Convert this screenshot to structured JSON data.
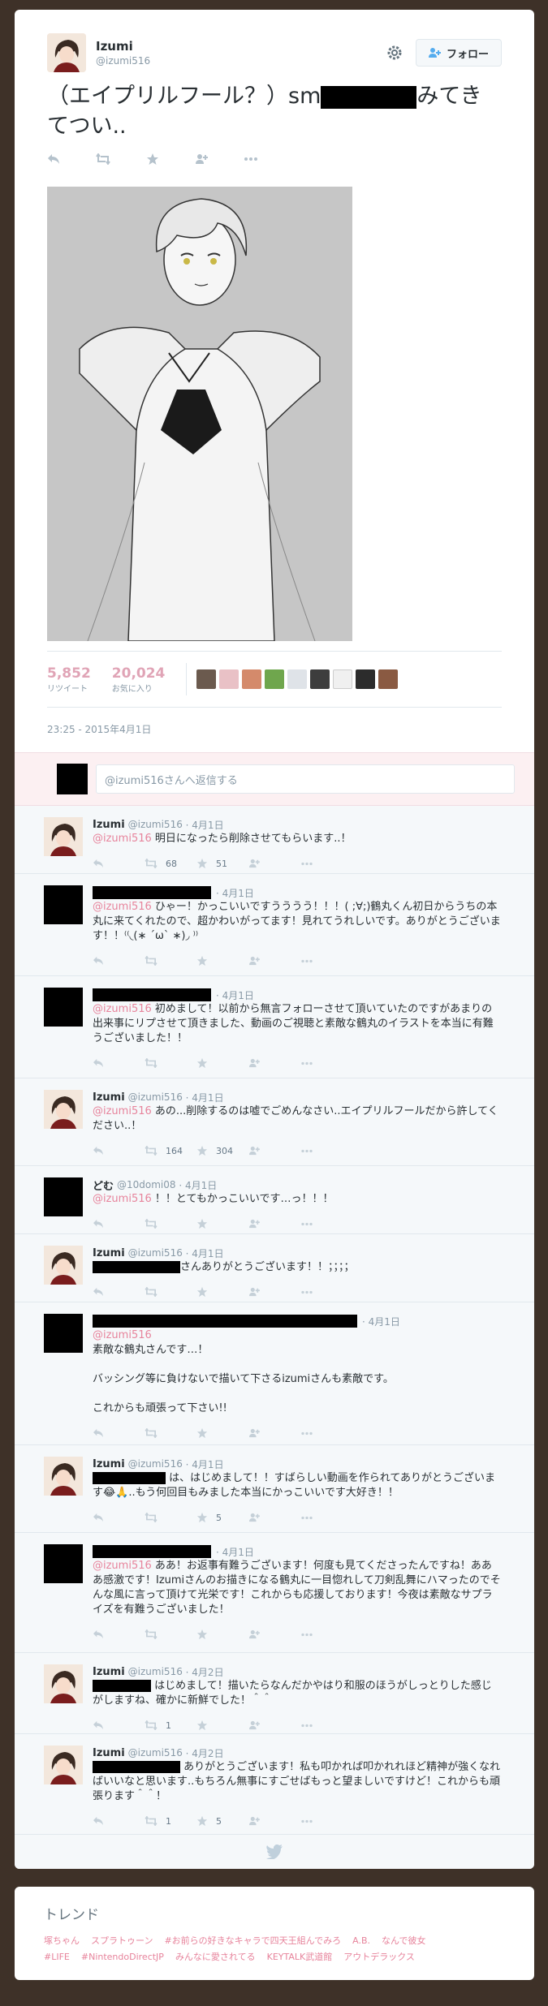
{
  "tweet": {
    "author_name": "Izumi",
    "author_handle": "@izumi516",
    "follow_label": "フォロー",
    "text_before": "（エイプリルフール？）sm",
    "text_after": "みてきてつい..",
    "retweets_count": "5,852",
    "retweets_label": "リツイート",
    "likes_count": "20,024",
    "likes_label": "お気に入り",
    "timestamp": "23:25 - 2015年4月1日"
  },
  "reply_box": {
    "placeholder": "@izumi516さんへ返信する"
  },
  "replies": [
    {
      "name": "Izumi",
      "handle": "@izumi516",
      "date": "· 4月1日",
      "mention": "@izumi516",
      "text": " 明日になったら削除させてもらいます..！",
      "rt": "68",
      "fav": "51"
    },
    {
      "name": "",
      "handle": "",
      "date": "· 4月1日",
      "mention": "@izumi516",
      "text": " ひゃー！かっこいいですうううう！！！( ;∀;)鶴丸くん初日からうちの本丸に来てくれたので、超かわいがってます！見れてうれしいです。ありがとうございます！！⁽⁽◟(∗ ˊωˋ ∗)◞ ⁾⁾",
      "rt": "",
      "fav": ""
    },
    {
      "name": "",
      "handle": "",
      "date": "· 4月1日",
      "mention": "@izumi516",
      "text": " 初めまして！以前から無言フォローさせて頂いていたのですがあまりの出来事にリプさせて頂きました、動画のご視聴と素敵な鶴丸のイラストを本当に有難うございました！！",
      "rt": "",
      "fav": ""
    },
    {
      "name": "Izumi",
      "handle": "@izumi516",
      "date": "· 4月1日",
      "mention": "@izumi516",
      "text": " あの...削除するのは嘘でごめんなさい..エイプリルフールだから許してください..！",
      "rt": "164",
      "fav": "304"
    },
    {
      "name": "どむ",
      "handle": "@10domi08",
      "date": "· 4月1日",
      "mention": "@izumi516",
      "text": " ！！とてもかっこいいです…っ！！！",
      "rt": "",
      "fav": ""
    },
    {
      "name": "Izumi",
      "handle": "@izumi516",
      "date": "· 4月1日",
      "mention": "",
      "text": "さんありがとうございます！！；；；；",
      "rt": "",
      "fav": ""
    },
    {
      "name": "",
      "handle": "",
      "date": "· 4月1日",
      "mention": "@izumi516",
      "text": "素敵な鶴丸さんです…！\n\nバッシング等に負けないで描いて下さるizumiさんも素敵です。\n\nこれからも頑張って下さい!!",
      "rt": "",
      "fav": ""
    },
    {
      "name": "Izumi",
      "handle": "@izumi516",
      "date": "· 4月1日",
      "mention": "",
      "text": " は、はじめまして！！すばらしい動画を作られてありがとうございます😂🙏..もう何回目もみました本当にかっこいいです大好き！！",
      "rt": "",
      "fav": "5"
    },
    {
      "name": "",
      "handle": "",
      "date": "· 4月1日",
      "mention": "@izumi516",
      "text": " ああ！お返事有難うございます！何度も見てくださったんですね！あああ感激です！Izumiさんのお描きになる鶴丸に一目惚れして刀剣乱舞にハマったのでそんな風に言って頂けて光栄です！これからも応援しております！今夜は素敵なサプライズを有難うございました！",
      "rt": "",
      "fav": ""
    },
    {
      "name": "Izumi",
      "handle": "@izumi516",
      "date": "· 4月2日",
      "mention": "",
      "text": " はじめまして！描いたらなんだかやはり和服のほうがしっとりした感じがしますね、確かに新鮮でした！＾＾",
      "rt": "1",
      "fav": ""
    },
    {
      "name": "Izumi",
      "handle": "@izumi516",
      "date": "· 4月2日",
      "mention": "",
      "text": " ありがとうございます！私も叩かれば叩かれれほど精神が強くなればいいなと思います..もちろん無事にすごせばもっと望ましいですけど！これからも頑張ります＾＾！",
      "rt": "1",
      "fav": "5"
    }
  ],
  "trends": {
    "title": "トレンド",
    "items": [
      "塚ちゃん",
      "スプラトゥーン",
      "#お前らの好きなキャラで四天王組んでみろ",
      "A.B.",
      "なんで彼女",
      "#LIFE",
      "#NintendoDirectJP",
      "みんなに愛されてる",
      "KEYTALK武道館",
      "アウトデラックス"
    ]
  },
  "icons": [
    "settings-gear-icon",
    "add-person-icon",
    "reply-icon",
    "retweet-icon",
    "favorite-star-icon",
    "follow-person-icon",
    "more-icon",
    "twitter-bird-icon"
  ],
  "colors": {
    "accent": "#e7849c",
    "stat": "#e0a4b6",
    "muted": "#8899a6",
    "background": "#3e3128"
  }
}
